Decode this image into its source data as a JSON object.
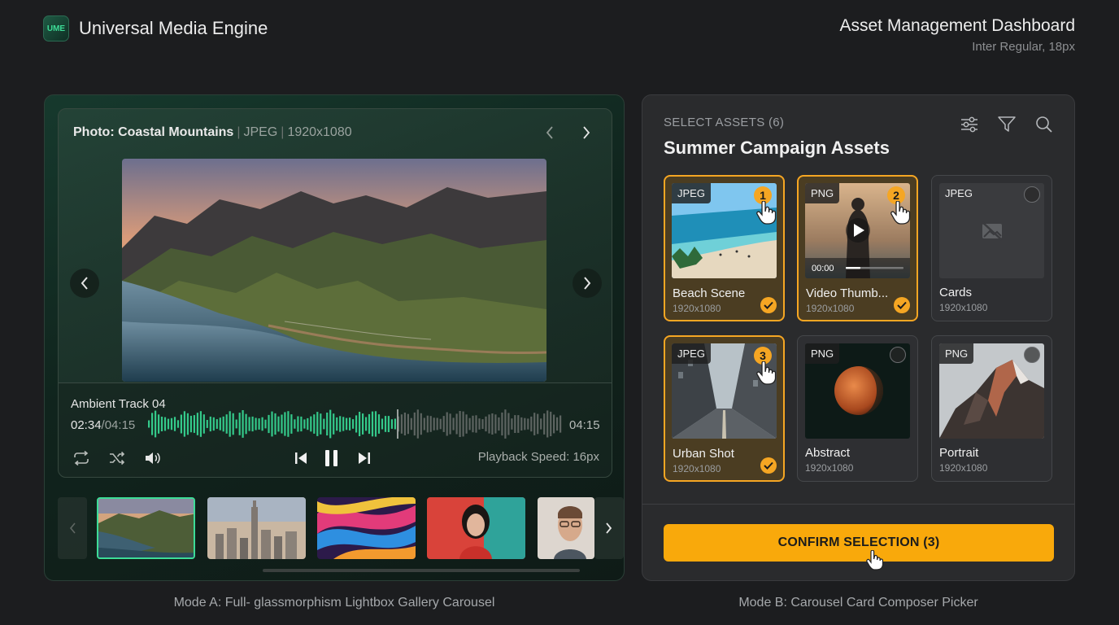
{
  "header": {
    "logo": "UME",
    "app_title": "Universal Media Engine",
    "dashboard_title": "Asset Management Dashboard",
    "dashboard_subtitle": "Inter Regular, 18px"
  },
  "mode_a": {
    "viewer": {
      "title": "Photo: Coastal Mountains",
      "format": "JPEG",
      "resolution": "1920x1080"
    },
    "audio": {
      "track": "Ambient Track 04",
      "current_time": "02:34",
      "total_time": "/04:15",
      "end_time": "04:15",
      "playback_speed": "Playback Speed: 16px",
      "progress": 0.6
    },
    "thumbnails": [
      "coastal-mountains",
      "city-skyline",
      "abstract-swirl",
      "portrait-woman",
      "portrait-man"
    ],
    "caption": "Mode A: Full- glassmorphism Lightbox Gallery Carousel"
  },
  "mode_b": {
    "select_label": "SELECT ASSETS (6)",
    "title": "Summer Campaign Assets",
    "cards": [
      {
        "format": "JPEG",
        "name": "Beach Scene",
        "dims": "1920x1080",
        "selected": true,
        "order": "1"
      },
      {
        "format": "PNG",
        "name": "Video Thumb...",
        "dims": "1920x1080",
        "selected": true,
        "order": "2",
        "video_time": "00:00"
      },
      {
        "format": "JPEG",
        "name": "Cards",
        "dims": "1920x1080",
        "selected": false
      },
      {
        "format": "JPEG",
        "name": "Urban Shot",
        "dims": "1920x1080",
        "selected": true,
        "order": "3"
      },
      {
        "format": "PNG",
        "name": "Abstract",
        "dims": "1920x1080",
        "selected": false
      },
      {
        "format": "PNG",
        "name": "Portrait",
        "dims": "1920x1080",
        "selected": false
      }
    ],
    "confirm_label": "CONFIRM SELECTION (3)",
    "caption": "Mode B: Carousel Card Composer Picker"
  },
  "colors": {
    "accent_green": "#3ddc97",
    "accent_amber": "#f5a623",
    "background": "#1c1d1f"
  }
}
